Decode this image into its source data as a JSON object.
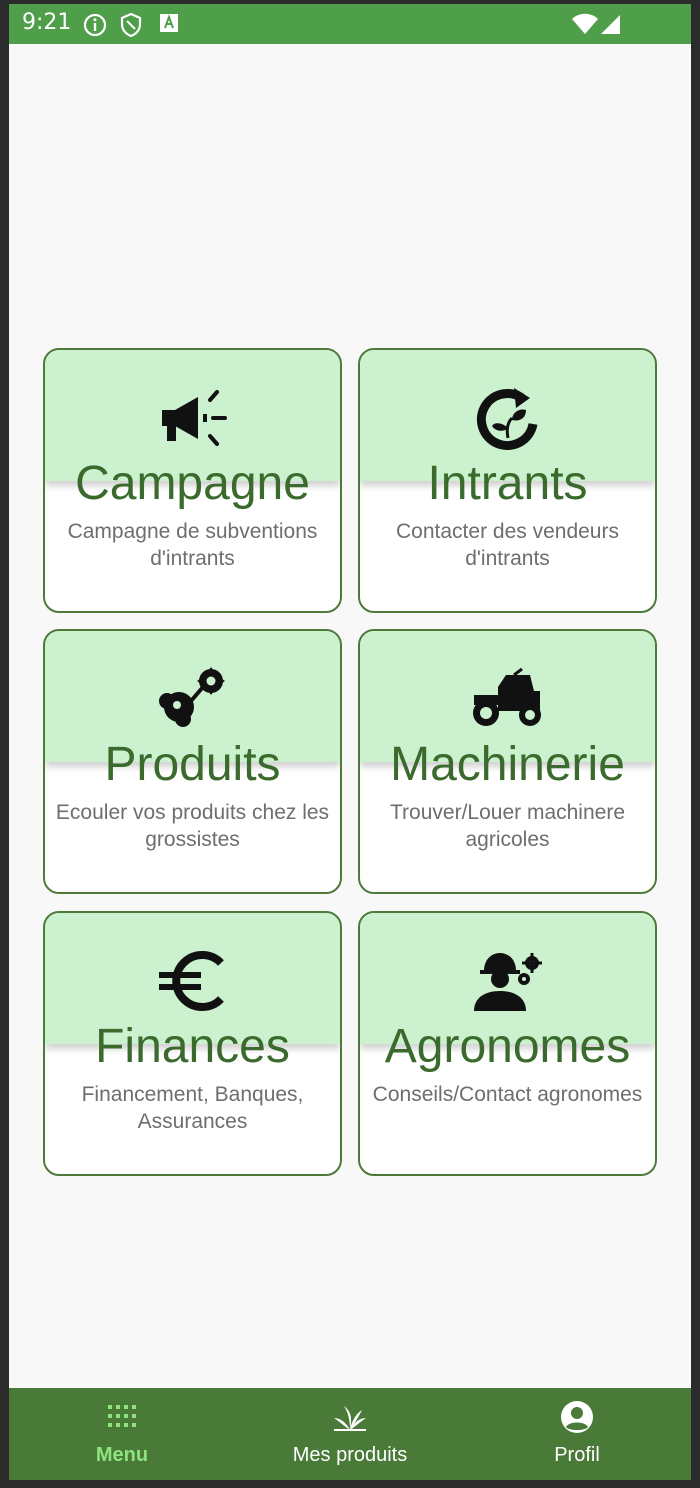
{
  "status_bar": {
    "time": "9:21"
  },
  "cards": [
    {
      "title": "Campagne",
      "description": "Campagne de subventions d'intrants",
      "icon": "megaphone-icon"
    },
    {
      "title": "Intrants",
      "description": "Contacter des vendeurs d'intrants",
      "icon": "recycle-plant-icon"
    },
    {
      "title": "Produits",
      "description": "Ecouler vos produits chez les grossistes",
      "icon": "produce-icon"
    },
    {
      "title": "Machinerie",
      "description": "Trouver/Louer machinere agricoles",
      "icon": "tractor-icon"
    },
    {
      "title": "Finances",
      "description": "Financement, Banques, Assurances",
      "icon": "euro-icon"
    },
    {
      "title": "Agronomes",
      "description": "Conseils/Contact agronomes",
      "icon": "agronomist-icon"
    }
  ],
  "bottom_nav": [
    {
      "label": "Menu",
      "icon": "grid-icon",
      "active": true
    },
    {
      "label": "Mes produits",
      "icon": "sprout-icon",
      "active": false
    },
    {
      "label": "Profil",
      "icon": "profile-icon",
      "active": false
    }
  ],
  "colors": {
    "status_bar": "#4f9e4a",
    "card_header": "#cbf1ce",
    "title_text": "#3a6b2c",
    "nav_bar": "#4a7a38",
    "nav_active": "#8ee37e"
  }
}
